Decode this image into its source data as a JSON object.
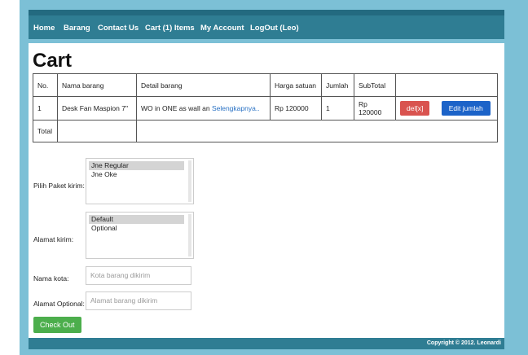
{
  "nav": {
    "home": "Home",
    "barang": "Barang",
    "contact": "Contact Us",
    "cart": "Cart (1) Items",
    "account": "My Account",
    "logout": "LogOut (Leo)"
  },
  "page_title": "Cart",
  "table": {
    "headers": {
      "no": "No.",
      "nama": "Nama barang",
      "detail": "Detail barang",
      "harga": "Harga satuan",
      "jumlah": "Jumlah",
      "subtotal": "SubTotal"
    },
    "rows": [
      {
        "no": "1",
        "nama": "Desk Fan Maspion 7\"",
        "detail": "WO in ONE as wall an",
        "detail_link": "Selengkapnya..",
        "harga": "Rp 120000",
        "jumlah": "1",
        "subtotal": "Rp 120000",
        "delete_label": "del[x]",
        "edit_label": "Edit jumlah"
      }
    ],
    "total_label": "Total"
  },
  "form": {
    "paket_label": "Pilih Paket kirim:",
    "paket_options": [
      "Jne Regular",
      "Jne Oke"
    ],
    "alamat_label": "Alamat kirim:",
    "alamat_options": [
      "Default",
      "Optional"
    ],
    "kota_label": "Nama kota:",
    "kota_placeholder": "Kota barang dikirim",
    "alamat_opt_label": "Alamat Optional:",
    "alamat_opt_placeholder": "Alamat barang dikirim",
    "checkout_label": "Check Out"
  },
  "footer": {
    "copyright": "Copyright © 2012. Leonardi"
  },
  "colors": {
    "navbar": "#2f7d93",
    "frame": "#7cc0d6",
    "delete_button": "#d9534f",
    "edit_button": "#1c63c8",
    "checkout_button": "#4cae4c",
    "link": "#2a72c4"
  }
}
